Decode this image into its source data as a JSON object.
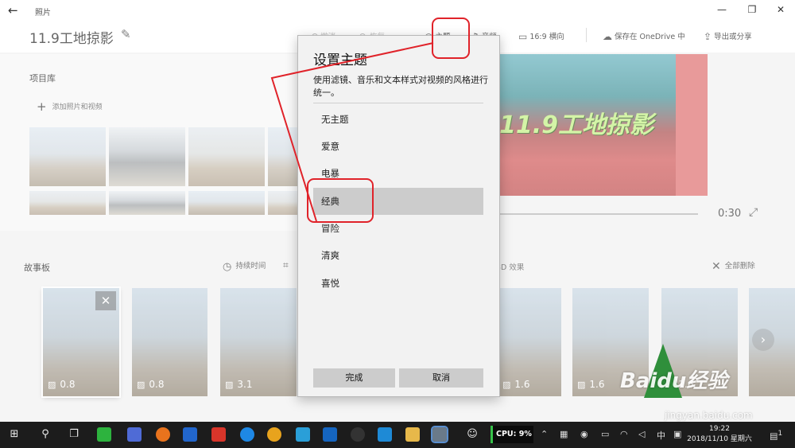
{
  "titlebar": {
    "back_glyph": "←",
    "app_title": "照片",
    "minimize": "—",
    "restore": "❐",
    "close": "✕"
  },
  "header": {
    "project_title": "11.9工地掠影",
    "undo": "撤消",
    "redo": "恢复",
    "theme": "主题",
    "music": "音频",
    "aspect": "16:9 横向",
    "save_onedrive": "保存在 OneDrive 中",
    "export_share": "导出或分享"
  },
  "library": {
    "title": "项目库",
    "add_label": "添加照片和视频"
  },
  "preview": {
    "title_text": "11.9工地掠影",
    "time": "0:30"
  },
  "storyboard": {
    "title": "故事板",
    "duration": "持续时间",
    "effects_3d": "3D 效果",
    "remove_all": "全部删除",
    "cards": [
      {
        "duration": "0.8"
      },
      {
        "duration": "0.8"
      },
      {
        "duration": "3.1"
      },
      {
        "duration": "1.6"
      },
      {
        "duration": "1.6"
      },
      {
        "duration": "1.6"
      }
    ]
  },
  "dialog": {
    "title": "设置主题",
    "description": "使用滤镜、音乐和文本样式对视频的风格进行统一。",
    "options": [
      "无主题",
      "爱意",
      "电暴",
      "经典",
      "冒险",
      "清爽",
      "喜悦"
    ],
    "selected": "经典",
    "done": "完成",
    "cancel": "取消"
  },
  "taskbar": {
    "cpu": "CPU: 9%",
    "ime": "中",
    "time": "19:22",
    "date": "2018/11/10 星期六",
    "notif_count": "1"
  },
  "watermark": {
    "brand": "Baidu经验",
    "url": "jingyan.baidu.com"
  },
  "colors": {
    "annotation": "#e0232a",
    "selected_option": "#cccccc",
    "cpu_bar": "#36c24a"
  }
}
